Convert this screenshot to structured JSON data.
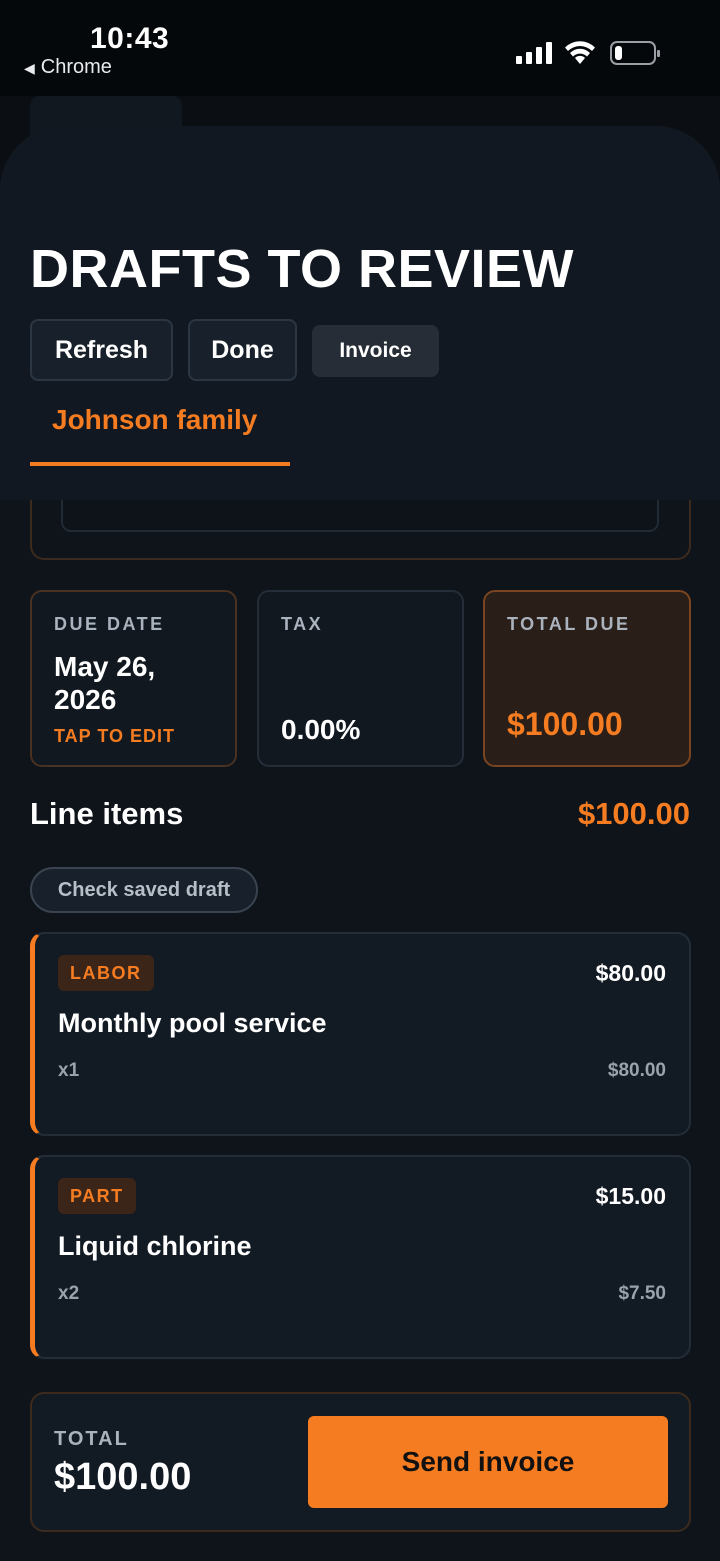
{
  "status_bar": {
    "time": "10:43",
    "back_app": "Chrome",
    "back_icon": "back-triangle-icon",
    "battery_level": 0.2
  },
  "header": {
    "title": "DRAFTS TO REVIEW",
    "buttons": {
      "refresh": "Refresh",
      "done": "Done",
      "invoice": "Invoice"
    },
    "active_tab": "Johnson family"
  },
  "summary": {
    "due_date_label": "DUE DATE",
    "due_date_value": "May 26, 2026",
    "due_date_action": "TAP TO EDIT",
    "tax_label": "TAX",
    "tax_value": "0.00%",
    "total_due_label": "TOTAL DUE",
    "total_due_value": "$100.00"
  },
  "line_items": {
    "title": "Line items",
    "total": "$100.00",
    "check_draft_label": "Check saved draft",
    "items": [
      {
        "type": "LABOR",
        "amount": "$80.00",
        "name": "Monthly pool service",
        "qty": "x1",
        "unit_price": "$80.00"
      },
      {
        "type": "PART",
        "amount": "$15.00",
        "name": "Liquid chlorine",
        "qty": "x2",
        "unit_price": "$7.50"
      }
    ]
  },
  "footer": {
    "total_label": "TOTAL",
    "total_value": "$100.00",
    "send_label": "Send invoice"
  },
  "colors": {
    "accent": "#f57c21",
    "background": "#0f141b",
    "card": "#121a23"
  }
}
